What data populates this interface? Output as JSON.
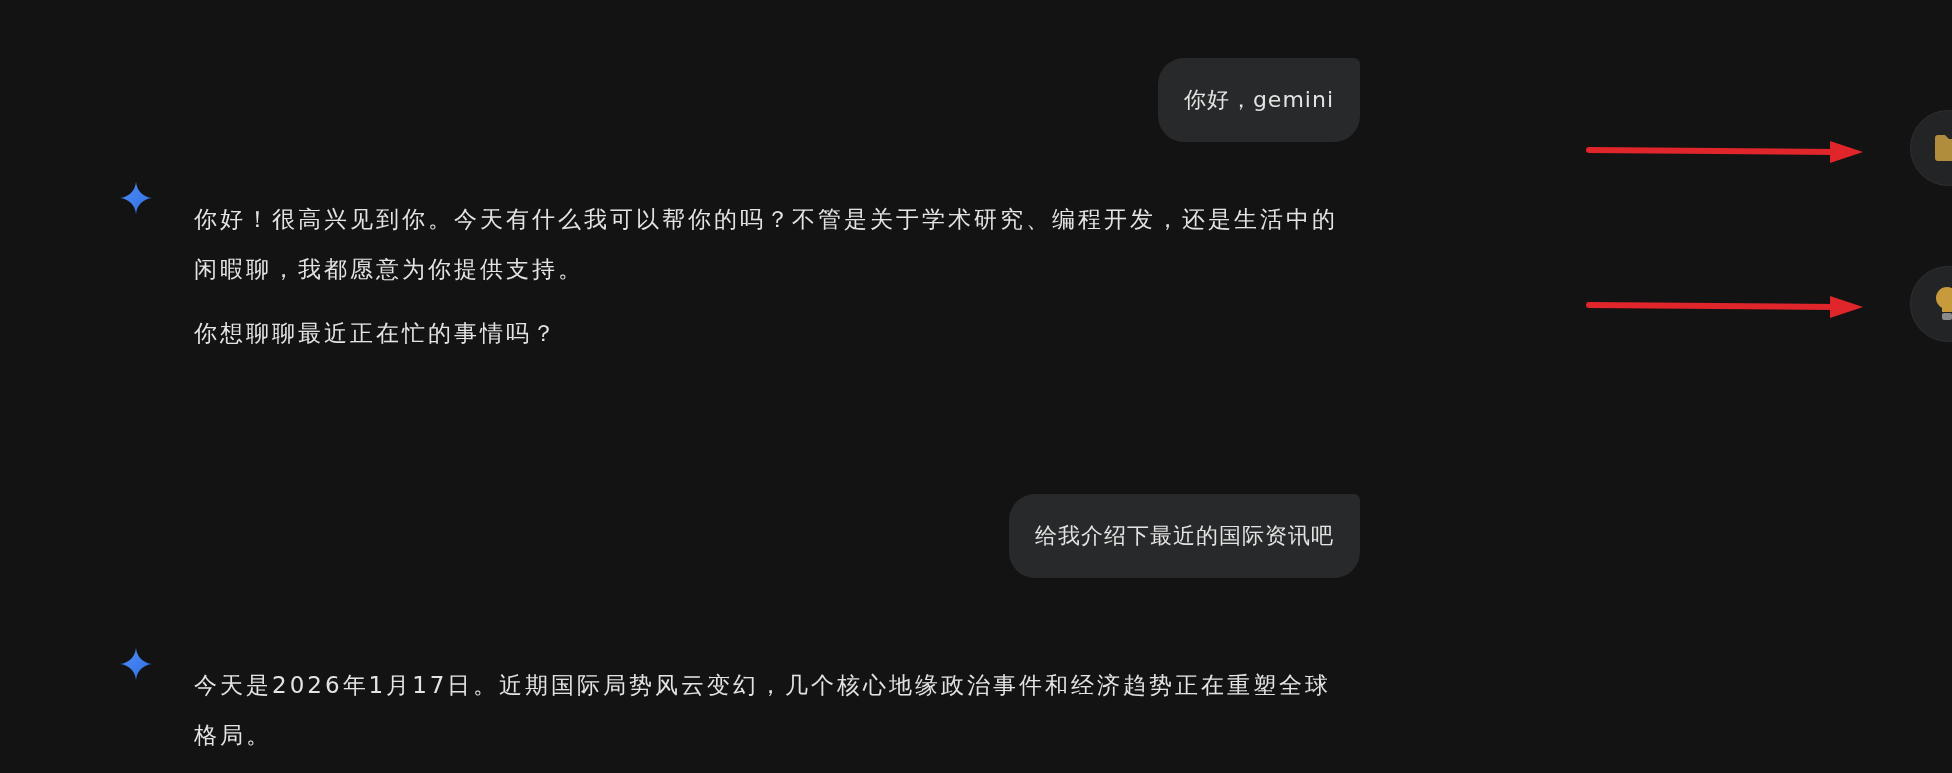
{
  "messages": [
    {
      "kind": "user",
      "text": "你好，gemini"
    },
    {
      "kind": "model",
      "paragraphs": [
        "你好！很高兴见到你。今天有什么我可以帮你的吗？不管是关于学术研究、编程开发，还是生活中的闲暇聊，我都愿意为你提供支持。",
        "你想聊聊最近正在忙的事情吗？"
      ]
    },
    {
      "kind": "user",
      "text": "给我介绍下最近的国际资讯吧"
    },
    {
      "kind": "model",
      "paragraphs": [
        "今天是2026年1月17日。近期国际局势风云变幻，几个核心地缘政治事件和经济趋势正在重塑全球格局。"
      ]
    }
  ],
  "side_buttons": [
    {
      "kind": "folder"
    },
    {
      "kind": "lightbulb"
    }
  ]
}
